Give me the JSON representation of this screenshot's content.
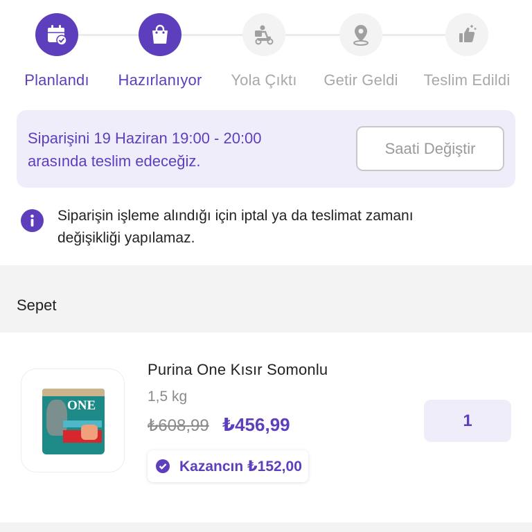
{
  "stepper": {
    "steps": [
      {
        "label": "Planlandı",
        "icon": "calendar-check-icon",
        "state": "done"
      },
      {
        "label": "Hazırlanıyor",
        "icon": "shopping-bag-icon",
        "state": "current"
      },
      {
        "label": "Yola Çıktı",
        "icon": "delivery-scooter-icon",
        "state": "pending"
      },
      {
        "label": "Getir Geldi",
        "icon": "map-pin-icon",
        "state": "pending"
      },
      {
        "label": "Teslim Edildi",
        "icon": "thumbs-up-icon",
        "state": "pending"
      }
    ]
  },
  "delivery_info": {
    "line1": "Siparişini 19 Haziran 19:00 - 20:00",
    "line2": "arasında teslim edeceğiz.",
    "change_button": "Saati Değiştir"
  },
  "notice": {
    "icon": "info-icon",
    "line1": "Siparişin işleme alındığı için iptal ya da teslimat zamanı",
    "line2": "değişikliği yapılamaz."
  },
  "cart": {
    "title": "Sepet",
    "items": [
      {
        "name": "Purina One Kısır Somonlu",
        "weight": "1,5 kg",
        "old_price": "₺608,99",
        "new_price": "₺456,99",
        "savings": "Kazancın ₺152,00",
        "quantity": "1",
        "bag_brand": "ONE"
      }
    ]
  },
  "colors": {
    "accent": "#5d3ebc",
    "accent_light": "#f0edfb",
    "inactive": "#a8a8a8",
    "section_bg": "#f3f3f4"
  }
}
